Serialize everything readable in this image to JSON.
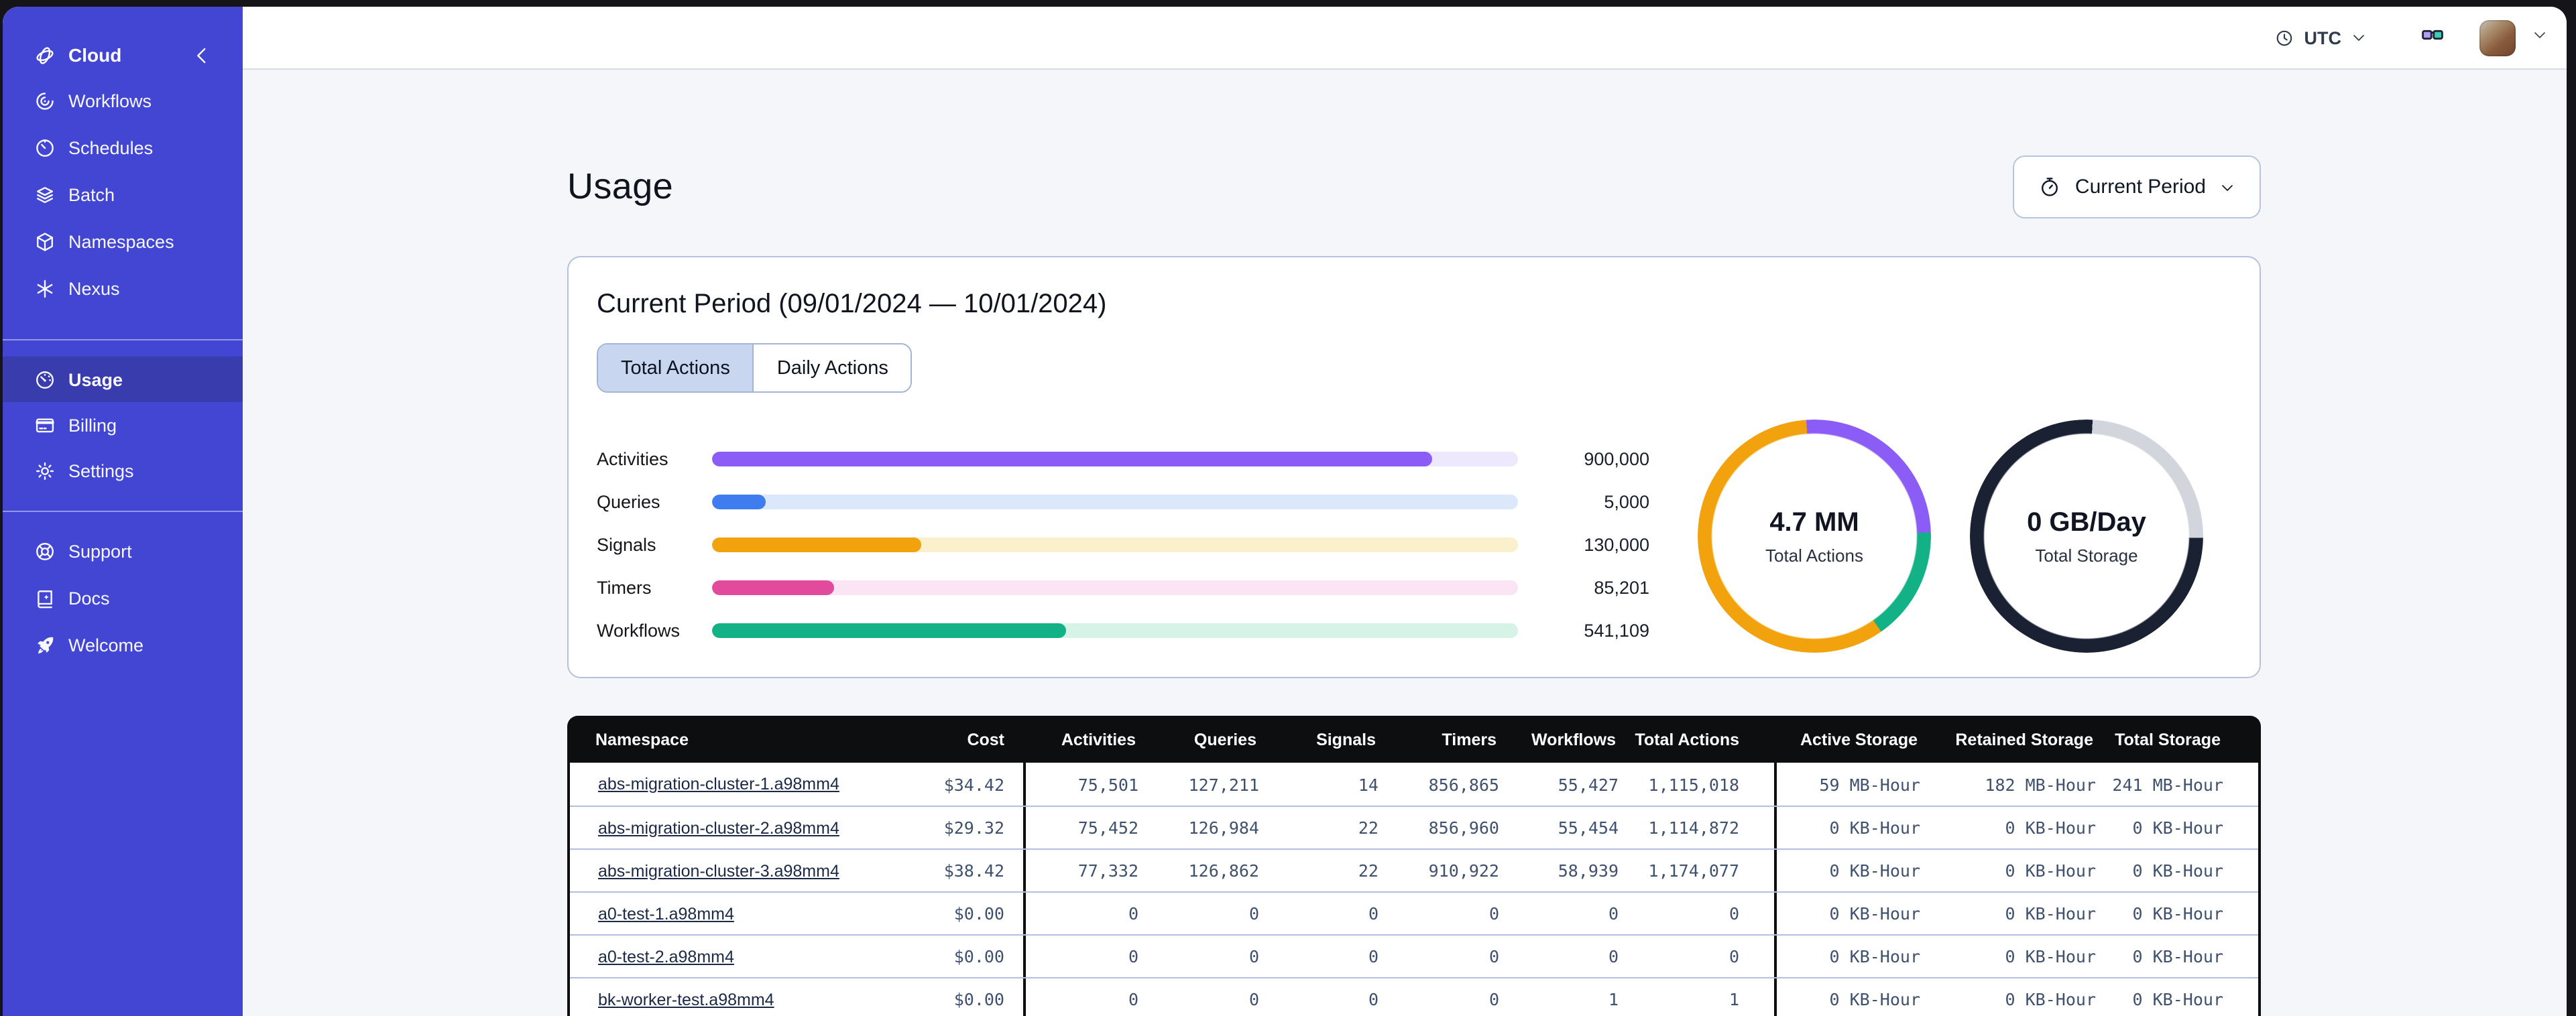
{
  "topbar": {
    "timezone_label": "UTC"
  },
  "sidebar": {
    "header": {
      "label": "Cloud",
      "icon": "temporal-logo-icon"
    },
    "groups": [
      {
        "items": [
          {
            "label": "Workflows",
            "icon": "workflows-icon"
          },
          {
            "label": "Schedules",
            "icon": "schedules-icon"
          },
          {
            "label": "Batch",
            "icon": "batch-icon"
          },
          {
            "label": "Namespaces",
            "icon": "namespaces-icon"
          },
          {
            "label": "Nexus",
            "icon": "nexus-icon"
          }
        ]
      },
      {
        "items": [
          {
            "label": "Usage",
            "icon": "gauge-icon",
            "active": true
          },
          {
            "label": "Billing",
            "icon": "credit-card-icon"
          },
          {
            "label": "Settings",
            "icon": "gear-icon"
          }
        ]
      },
      {
        "items": [
          {
            "label": "Support",
            "icon": "life-buoy-icon"
          },
          {
            "label": "Docs",
            "icon": "book-icon"
          },
          {
            "label": "Welcome",
            "icon": "rocket-icon"
          }
        ]
      }
    ],
    "colors": {
      "background": "#4246d2",
      "active_item": "#383cac"
    }
  },
  "page": {
    "title": "Usage",
    "period_selector": {
      "label": "Current Period",
      "icon": "stopwatch-icon"
    }
  },
  "usage_card": {
    "title": "Current Period (09/01/2024 — 10/01/2024)",
    "tabs": [
      {
        "label": "Total Actions",
        "active": true
      },
      {
        "label": "Daily Actions",
        "active": false
      }
    ]
  },
  "chart_data": [
    {
      "type": "bar",
      "title": "Total Actions by type",
      "categories": [
        "Activities",
        "Queries",
        "Signals",
        "Timers",
        "Workflows"
      ],
      "values": [
        900000,
        5000,
        130000,
        85201,
        541109
      ],
      "value_labels": [
        "900,000",
        "5,000",
        "130,000",
        "85,201",
        "541,109"
      ],
      "fill_fractions": [
        0.893,
        0.066,
        0.259,
        0.152,
        0.439
      ],
      "colors": [
        "#8b5cf6",
        "#3f7cef",
        "#f2a20d",
        "#e24b9c",
        "#13b286"
      ],
      "track_colors": [
        "#ede8fc",
        "#dbe7fb",
        "#fbf0cc",
        "#fbe4f4",
        "#d5f3e6"
      ]
    },
    {
      "type": "pie",
      "title": "Total Actions donut",
      "center_value": "4.7 MM",
      "center_label": "Total Actions",
      "start_angle_deg": -4,
      "slices": [
        {
          "name": "activities",
          "pct": 25.6,
          "color": "#8b5cf6"
        },
        {
          "name": "workflows",
          "pct": 15.8,
          "color": "#13b286"
        },
        {
          "name": "signals",
          "pct": 58.6,
          "color": "#f2a20d"
        }
      ]
    },
    {
      "type": "pie",
      "title": "Total Storage donut",
      "center_value": "0 GB/Day",
      "center_label": "Total Storage",
      "start_angle_deg": 3,
      "slices": [
        {
          "name": "free",
          "pct": 24.4,
          "color": "#d2d5dc"
        },
        {
          "name": "used",
          "pct": 75.6,
          "color": "#1a2133"
        }
      ]
    }
  ],
  "table": {
    "columns": [
      "Namespace",
      "Cost",
      "Activities",
      "Queries",
      "Signals",
      "Timers",
      "Workflows",
      "Total Actions",
      "Active Storage",
      "Retained Storage",
      "Total Storage"
    ],
    "rows": [
      [
        "abs-migration-cluster-1.a98mm4",
        "$34.42",
        "75,501",
        "127,211",
        "14",
        "856,865",
        "55,427",
        "1,115,018",
        "59 MB-Hour",
        "182 MB-Hour",
        "241 MB-Hour"
      ],
      [
        "abs-migration-cluster-2.a98mm4",
        "$29.32",
        "75,452",
        "126,984",
        "22",
        "856,960",
        "55,454",
        "1,114,872",
        "0 KB-Hour",
        "0 KB-Hour",
        "0 KB-Hour"
      ],
      [
        "abs-migration-cluster-3.a98mm4",
        "$38.42",
        "77,332",
        "126,862",
        "22",
        "910,922",
        "58,939",
        "1,174,077",
        "0 KB-Hour",
        "0 KB-Hour",
        "0 KB-Hour"
      ],
      [
        "a0-test-1.a98mm4",
        "$0.00",
        "0",
        "0",
        "0",
        "0",
        "0",
        "0",
        "0 KB-Hour",
        "0 KB-Hour",
        "0 KB-Hour"
      ],
      [
        "a0-test-2.a98mm4",
        "$0.00",
        "0",
        "0",
        "0",
        "0",
        "0",
        "0",
        "0 KB-Hour",
        "0 KB-Hour",
        "0 KB-Hour"
      ],
      [
        "bk-worker-test.a98mm4",
        "$0.00",
        "0",
        "0",
        "0",
        "0",
        "1",
        "1",
        "0 KB-Hour",
        "0 KB-Hour",
        "0 KB-Hour"
      ]
    ]
  }
}
